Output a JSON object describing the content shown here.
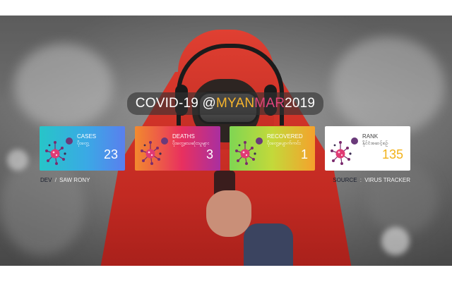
{
  "header": {
    "part1": "COVID-19 @ ",
    "part2": "MYAN",
    "part3": "MAR",
    "part4": " 2019"
  },
  "cards": [
    {
      "label": "CASES",
      "sublabel": "ပိုးတွေ့",
      "value": "23"
    },
    {
      "label": "DEATHS",
      "sublabel": "ပိုးတွေ့သေဆုံးသူများ",
      "value": "3"
    },
    {
      "label": "RECOVERED",
      "sublabel": "ပိုးတွေ့ပျောက်ကင်း",
      "value": "1"
    },
    {
      "label": "RANK",
      "sublabel": "နိုင်ငံအဆင့်စဉ်",
      "value": "135"
    }
  ],
  "footer": {
    "dev_label": "DEV",
    "dev_sep": "/",
    "dev_name": "SAW RONY",
    "source_label": "SOURCE",
    "source_sep": ":",
    "source_name": "VIRUS TRACKER"
  },
  "colors": {
    "title_accent_yellow": "#f7b52c",
    "title_accent_pink": "#e3447c",
    "rank_value": "#f2b21a"
  },
  "icons": {
    "card_icon": "virus-icon"
  }
}
